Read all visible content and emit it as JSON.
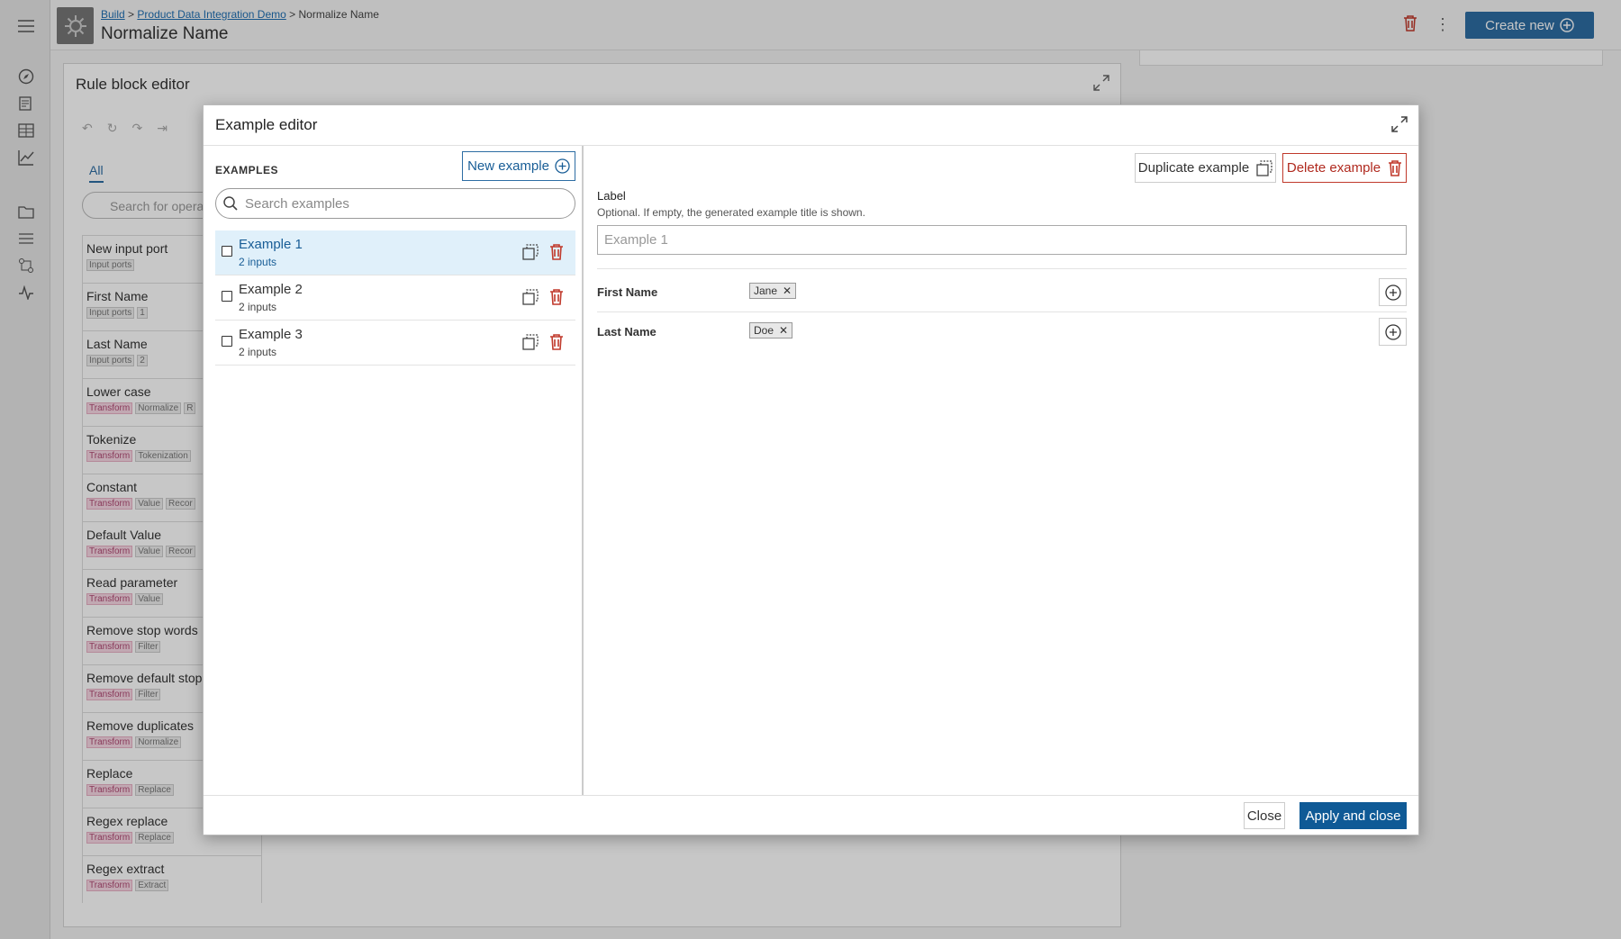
{
  "breadcrumb": {
    "root": "Build",
    "separator": ">",
    "project": "Product Data Integration Demo",
    "current": "Normalize Name"
  },
  "page_title": "Normalize Name",
  "header": {
    "create_label": "Create new"
  },
  "rule_editor": {
    "title": "Rule block editor",
    "filter_all": "All",
    "search_placeholder": "Search for opera",
    "operators": [
      {
        "name": "New input port",
        "tags": [
          "Input ports"
        ]
      },
      {
        "name": "First Name",
        "tags": [
          "Input ports",
          "1"
        ]
      },
      {
        "name": "Last Name",
        "tags": [
          "Input ports",
          "2"
        ]
      },
      {
        "name": "Lower case",
        "tags": [
          "Transform",
          "Normalize",
          "R"
        ]
      },
      {
        "name": "Tokenize",
        "tags": [
          "Transform",
          "Tokenization"
        ]
      },
      {
        "name": "Constant",
        "tags": [
          "Transform",
          "Value",
          "Recor"
        ]
      },
      {
        "name": "Default Value",
        "tags": [
          "Transform",
          "Value",
          "Recor"
        ]
      },
      {
        "name": "Read parameter",
        "tags": [
          "Transform",
          "Value"
        ]
      },
      {
        "name": "Remove stop words",
        "tags": [
          "Transform",
          "Filter"
        ]
      },
      {
        "name": "Remove default stop",
        "tags": [
          "Transform",
          "Filter"
        ]
      },
      {
        "name": "Remove duplicates",
        "tags": [
          "Transform",
          "Normalize"
        ]
      },
      {
        "name": "Replace",
        "tags": [
          "Transform",
          "Replace"
        ]
      },
      {
        "name": "Regex replace",
        "tags": [
          "Transform",
          "Replace"
        ]
      },
      {
        "name": "Regex extract",
        "tags": [
          "Transform",
          "Extract"
        ]
      }
    ]
  },
  "modal": {
    "title": "Example editor",
    "examples_heading": "EXAMPLES",
    "new_example_label": "New example",
    "search_placeholder": "Search examples",
    "examples": [
      {
        "name": "Example 1",
        "sub": "2 inputs",
        "selected": true
      },
      {
        "name": "Example 2",
        "sub": "2 inputs",
        "selected": false
      },
      {
        "name": "Example 3",
        "sub": "2 inputs",
        "selected": false
      }
    ],
    "duplicate_label": "Duplicate example",
    "delete_label": "Delete example",
    "label_title": "Label",
    "label_help": "Optional. If empty, the generated example title is shown.",
    "label_placeholder": "Example 1",
    "fields": [
      {
        "name": "First Name",
        "value": "Jane"
      },
      {
        "name": "Last Name",
        "value": "Doe"
      }
    ],
    "close_label": "Close",
    "apply_label": "Apply and close"
  },
  "colors": {
    "accent": "#0f5a96",
    "danger": "#c0392b",
    "selected_row": "#e0f0fa",
    "transform_tag": "#f8d8e4"
  }
}
